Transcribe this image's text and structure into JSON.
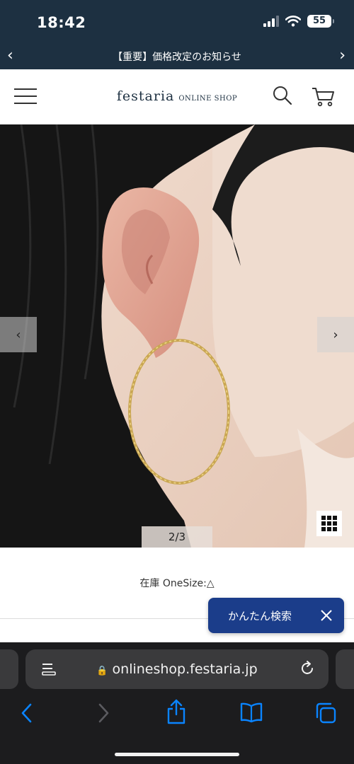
{
  "status_bar": {
    "time": "18:42",
    "battery": "55",
    "icons": [
      "cellular-signal-icon",
      "wifi-icon",
      "battery-icon"
    ]
  },
  "announcement": {
    "text": "【重要】価格改定のお知らせ",
    "prev_icon": "chevron-left-icon",
    "next_icon": "chevron-right-icon"
  },
  "header": {
    "brand": "festaria",
    "brand_sub": "ONLINE SHOP",
    "menu_icon": "hamburger-menu-icon",
    "search_icon": "search-icon",
    "cart_icon": "cart-icon",
    "brand_color": "#1d3041"
  },
  "gallery": {
    "counter": "2/3",
    "prev_label": "‹",
    "next_label": "›",
    "grid_icon": "grid-view-icon"
  },
  "product": {
    "stock_text": "在庫 OneSize:△"
  },
  "easy_search": {
    "label": "かんたん検索",
    "close_icon": "close-icon",
    "color": "#1b3d8a"
  },
  "browser": {
    "url": "onlineshop.festaria.jp",
    "icons": [
      "reader-icon",
      "lock-icon",
      "reload-icon",
      "back-icon",
      "forward-icon",
      "share-icon",
      "bookmarks-icon",
      "tabs-icon"
    ],
    "accent": "#0a84ff"
  }
}
